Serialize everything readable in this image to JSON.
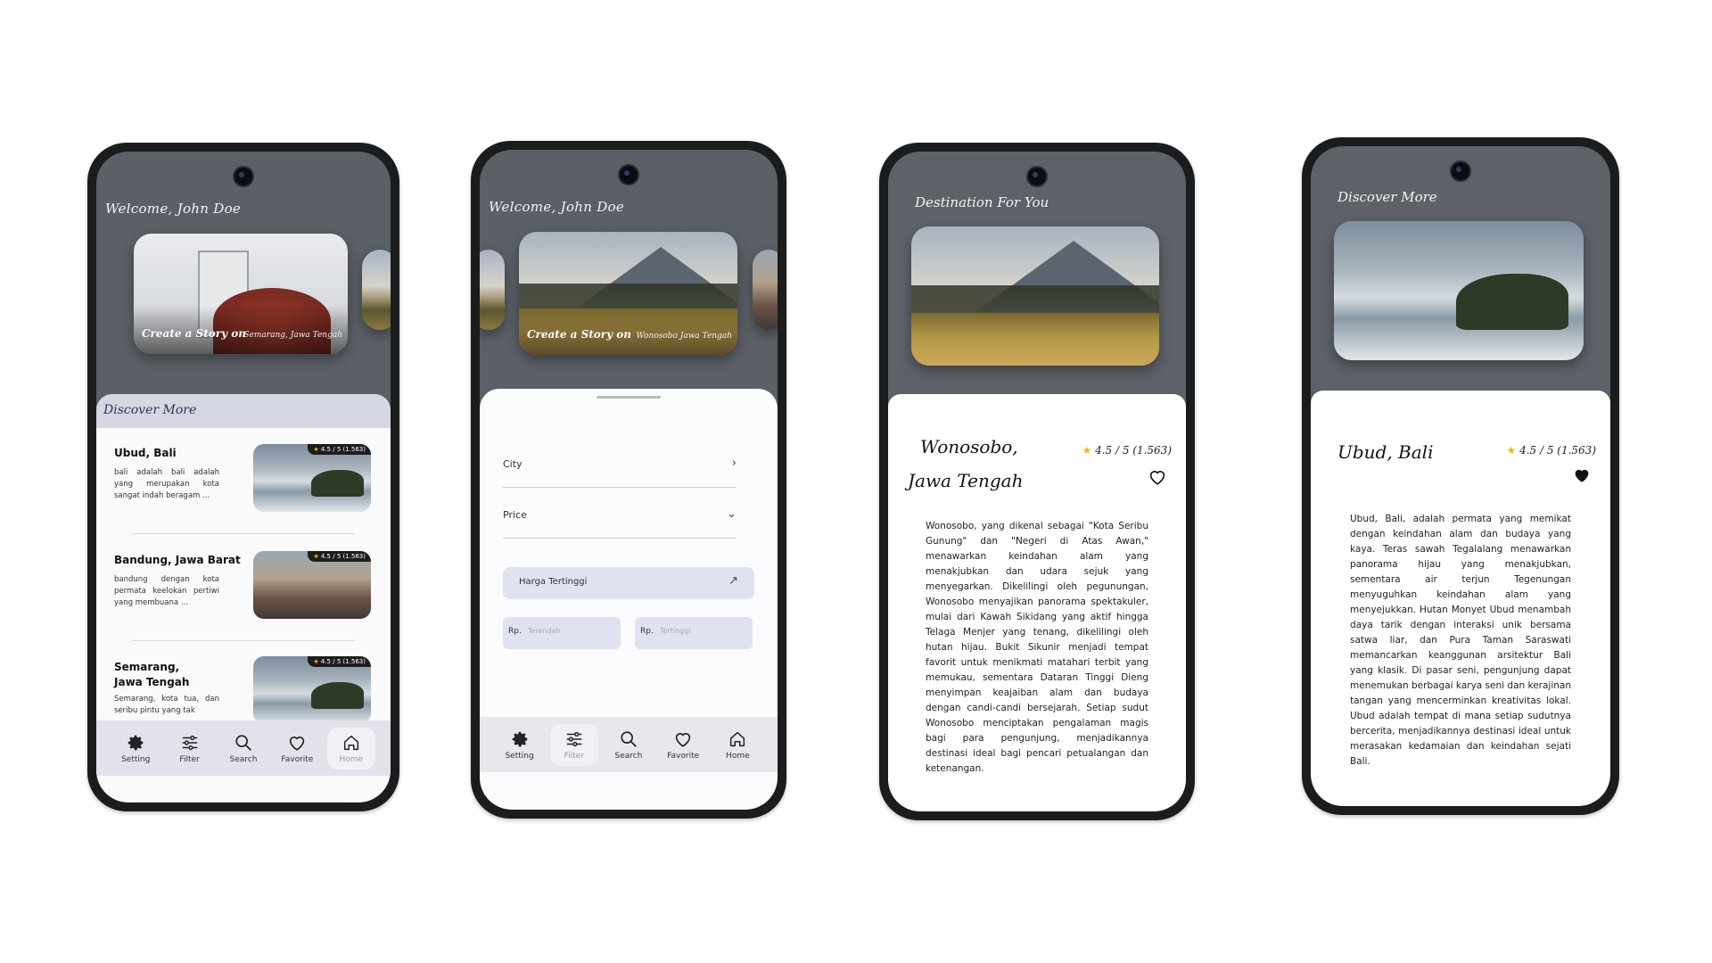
{
  "common": {
    "welcome": "Welcome, John Doe",
    "create_story": "Create a Story on",
    "rating": "4.5 / 5",
    "reviews": "(1.563)",
    "rating_full": "4.5 / 5 (1.563)",
    "nav": [
      {
        "label": "Setting",
        "icon": "gear-icon"
      },
      {
        "label": "Filter",
        "icon": "sliders-icon"
      },
      {
        "label": "Search",
        "icon": "search-icon"
      },
      {
        "label": "Favorite",
        "icon": "heart-icon"
      },
      {
        "label": "Home",
        "icon": "home-icon"
      }
    ]
  },
  "screen1": {
    "card_location": "Semarang, Jawa Tengah",
    "section_title": "Discover More",
    "items": [
      {
        "name": "Ubud, Bali",
        "desc": "bali adalah bali adalah yang merupakan kota sangat indah beragam ..."
      },
      {
        "name": "Bandung, Jawa Barat",
        "desc": "bandung dengan kota permata keelokan pertiwi yang membuana ..."
      },
      {
        "name": "Semarang,\nJawa Tengah",
        "desc": "Semarang, kota tua, dan seribu pintu yang tak"
      }
    ]
  },
  "screen2": {
    "card_location": "Wonosobo Jawa Tengah",
    "city_label": "City",
    "price_label": "Price",
    "sort_option": "Harga Tertinggi",
    "rp": "Rp.",
    "min_placeholder": "Terendah",
    "max_placeholder": "Tertinggi"
  },
  "screen3": {
    "header": "Destination For You",
    "title_line1": "Wonosobo,",
    "title_line2": "Jawa Tengah",
    "body": "Wonosobo, yang dikenal sebagai \"Kota Seribu Gunung\" dan \"Negeri di Atas Awan,\" menawarkan keindahan alam yang menakjubkan dan udara sejuk yang menyegarkan. Dikelilingi oleh pegunungan, Wonosobo menyajikan panorama spektakuler, mulai dari Kawah Sikidang yang aktif hingga Telaga Menjer yang tenang, dikelilingi oleh hutan hijau. Bukit Sikunir menjadi tempat favorit untuk menikmati matahari terbit yang memukau, sementara Dataran Tinggi Dieng menyimpan keajaiban alam dan budaya dengan candi-candi bersejarah. Setiap sudut Wonosobo menciptakan pengalaman magis bagi para pengunjung, menjadikannya destinasi ideal bagi pencari petualangan dan ketenangan."
  },
  "screen4": {
    "header": "Discover More",
    "title": "Ubud, Bali",
    "body": "Ubud, Bali, adalah permata yang memikat dengan keindahan alam dan budaya yang kaya. Teras sawah Tegalalang menawarkan panorama hijau yang menakjubkan, sementara air terjun Tegenungan menyuguhkan keindahan alam yang menyejukkan. Hutan Monyet Ubud menambah daya tarik dengan interaksi unik bersama satwa liar, dan Pura Taman Saraswati memancarkan keanggunan arsitektur Bali yang klasik. Di pasar seni, pengunjung dapat menemukan berbagai karya seni dan kerajinan tangan yang mencerminkan kreativitas lokal. Ubud adalah tempat di mana setiap sudutnya bercerita, menjadikannya destinasi ideal untuk merasakan kedamaian dan keindahan sejati Bali."
  }
}
